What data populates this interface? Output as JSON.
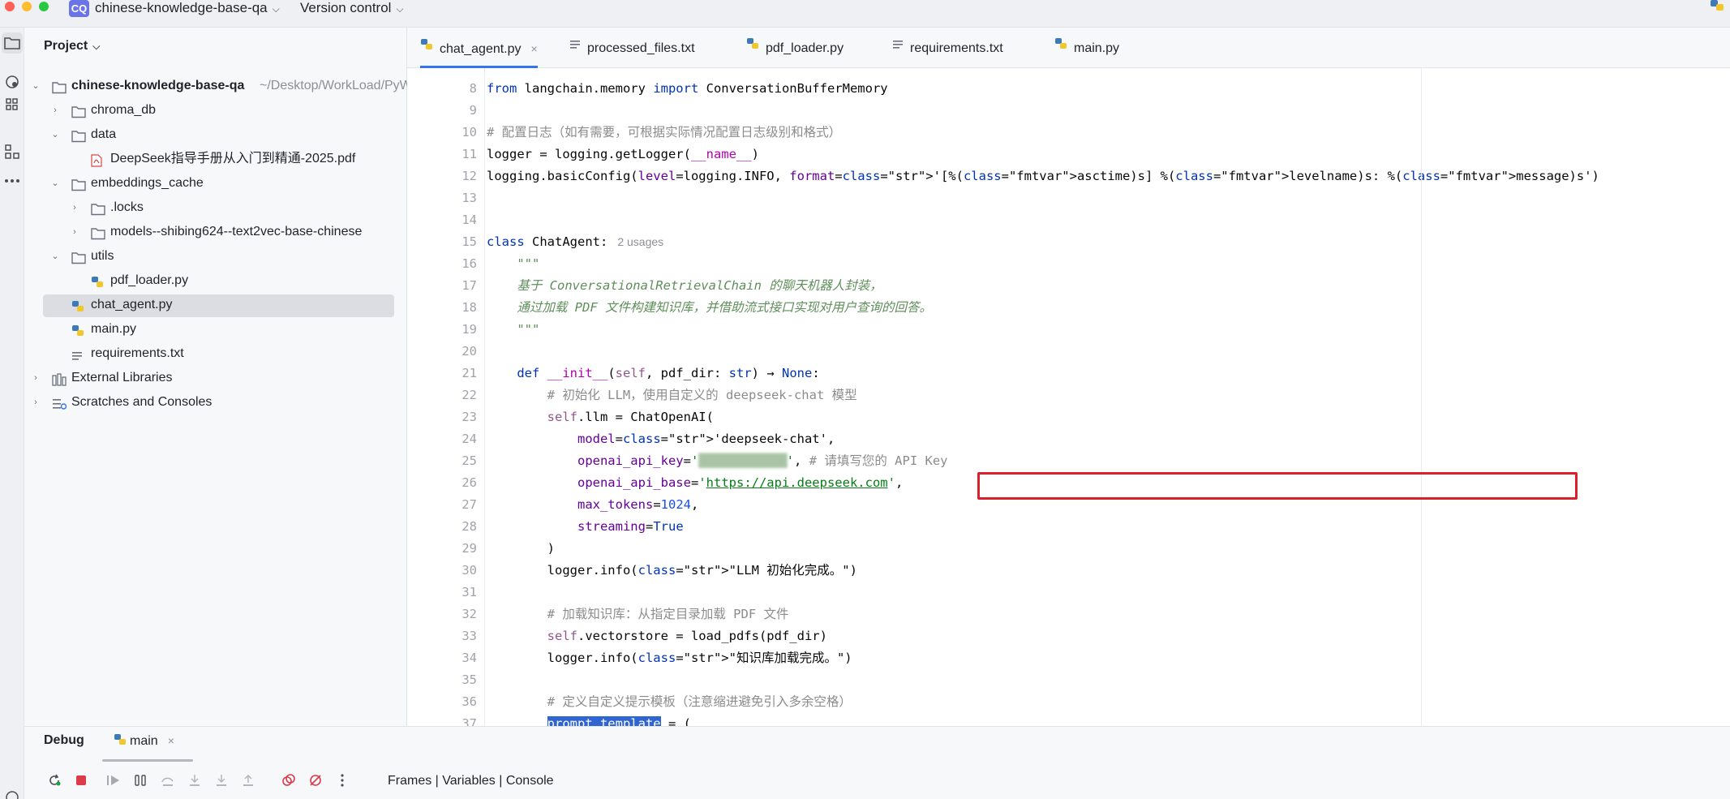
{
  "titlebar": {
    "project_badge": "CQ",
    "project_name": "chinese-knowledge-base-qa",
    "vcs_label": "Version control"
  },
  "project_panel": {
    "title": "Project",
    "tree": [
      {
        "label": "chinese-knowledge-base-qa",
        "hint": "~/Desktop/WorkLoad/PyW",
        "icon": "folder-icon",
        "bold": true
      },
      {
        "label": "chroma_db",
        "icon": "folder-icon"
      },
      {
        "label": "data",
        "icon": "folder-icon"
      },
      {
        "label": "DeepSeek指导手册从入门到精通-2025.pdf",
        "icon": "pdf-file-icon"
      },
      {
        "label": "embeddings_cache",
        "icon": "folder-icon"
      },
      {
        "label": ".locks",
        "icon": "folder-icon"
      },
      {
        "label": "models--shibing624--text2vec-base-chinese",
        "icon": "folder-icon"
      },
      {
        "label": "utils",
        "icon": "folder-icon"
      },
      {
        "label": "pdf_loader.py",
        "icon": "python-file-icon"
      },
      {
        "label": "chat_agent.py",
        "icon": "python-file-icon",
        "selected": true
      },
      {
        "label": "main.py",
        "icon": "python-file-icon"
      },
      {
        "label": "requirements.txt",
        "icon": "text-file-icon"
      },
      {
        "label": "External Libraries",
        "icon": "library-icon"
      },
      {
        "label": "Scratches and Consoles",
        "icon": "scratches-icon"
      }
    ]
  },
  "editor": {
    "tabs": [
      {
        "label": "chat_agent.py",
        "icon": "python-file-icon",
        "active": true,
        "close": "×"
      },
      {
        "label": "processed_files.txt",
        "icon": "text-file-icon"
      },
      {
        "label": "pdf_loader.py",
        "icon": "python-file-icon"
      },
      {
        "label": "requirements.txt",
        "icon": "text-file-icon"
      },
      {
        "label": "main.py",
        "icon": "python-file-icon"
      }
    ],
    "code_lines": [
      {
        "n": "8",
        "text": "from langchain.memory import ConversationBufferMemory"
      },
      {
        "n": "9",
        "text": ""
      },
      {
        "n": "10",
        "text": "# 配置日志（如有需要，可根据实际情况配置日志级别和格式）"
      },
      {
        "n": "11",
        "text": "logger = logging.getLogger(__name__)"
      },
      {
        "n": "12",
        "text": "logging.basicConfig(level=logging.INFO, format='[%(asctime)s] %(levelname)s: %(message)s')"
      },
      {
        "n": "13",
        "text": ""
      },
      {
        "n": "14",
        "text": ""
      },
      {
        "n": "15",
        "text": "class ChatAgent:",
        "inlay": "2 usages"
      },
      {
        "n": "16",
        "text": "    \"\"\""
      },
      {
        "n": "17",
        "text": "    基于 ConversationalRetrievalChain 的聊天机器人封装，"
      },
      {
        "n": "18",
        "text": "    通过加载 PDF 文件构建知识库，并借助流式接口实现对用户查询的回答。"
      },
      {
        "n": "19",
        "text": "    \"\"\""
      },
      {
        "n": "20",
        "text": ""
      },
      {
        "n": "21",
        "text": "    def __init__(self, pdf_dir: str) -> None:"
      },
      {
        "n": "22",
        "text": "        # 初始化 LLM，使用自定义的 deepseek-chat 模型"
      },
      {
        "n": "23",
        "text": "        self.llm = ChatOpenAI("
      },
      {
        "n": "24",
        "text": "            model='deepseek-chat',"
      },
      {
        "n": "25",
        "text": "            openai_api_key='█████████████', # 请填写您的 API Key"
      },
      {
        "n": "26",
        "text": "            openai_api_base='https://api.deepseek.com',"
      },
      {
        "n": "27",
        "text": "            max_tokens=1024,"
      },
      {
        "n": "28",
        "text": "            streaming=True"
      },
      {
        "n": "29",
        "text": "        )"
      },
      {
        "n": "30",
        "text": "        logger.info(\"LLM 初始化完成。\")"
      },
      {
        "n": "31",
        "text": ""
      },
      {
        "n": "32",
        "text": "        # 加载知识库：从指定目录加载 PDF 文件"
      },
      {
        "n": "33",
        "text": "        self.vectorstore = load_pdfs(pdf_dir)"
      },
      {
        "n": "34",
        "text": "        logger.info(\"知识库加载完成。\")"
      },
      {
        "n": "35",
        "text": ""
      },
      {
        "n": "36",
        "text": "        # 定义自定义提示模板（注意缩进避免引入多余空格）"
      },
      {
        "n": "37",
        "text": "        prompt_template = ("
      }
    ]
  },
  "debug_panel": {
    "title": "Debug",
    "tab_label": "main",
    "tab_close": "×",
    "views_label": "Frames | Variables | Console"
  },
  "colors": {
    "accent": "#3574f0",
    "highlight_box": "#d9202b",
    "project_badge": "#6b74e6"
  }
}
